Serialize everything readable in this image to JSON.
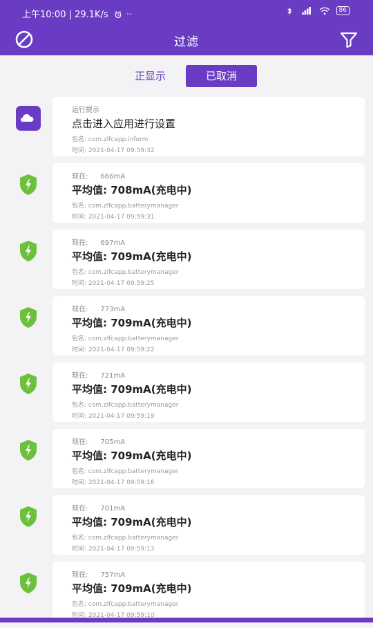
{
  "status_bar": {
    "left_text": "上午10:00 | 29.1K/s",
    "alarm_icon": "alarm-clock-icon",
    "more_dots": "··",
    "icons": [
      "bluetooth-icon",
      "signal-icon",
      "wifi-icon",
      "battery-icon"
    ],
    "battery_text": "86"
  },
  "app_bar": {
    "title": "过滤",
    "left_icon": "block-icon",
    "right_icon": "filter-icon"
  },
  "segmented": {
    "options": [
      "正显示",
      "已取消"
    ],
    "selected_index": 1
  },
  "colors": {
    "primary": "#6a3cc4",
    "green": "#6cc03c",
    "background": "#f3f3f5"
  },
  "notifications": [
    {
      "type": "app",
      "icon": "cloud-app-icon",
      "line1_label": "运行提示",
      "line1_value": "",
      "title": "点击进入应用进行设置",
      "package_label": "包名:",
      "package": "com.zlfcapp.inform",
      "time_label": "时间:",
      "time": "2021-04-17 09:59:32"
    },
    {
      "type": "battery",
      "icon": "shield-battery-icon",
      "line1_label": "现在:",
      "line1_value": "666mA",
      "title": "平均值:  708mA(充电中)",
      "package_label": "包名:",
      "package": "com.zlfcapp.batterymanager",
      "time_label": "时间:",
      "time": "2021-04-17 09:59:31"
    },
    {
      "type": "battery",
      "icon": "shield-battery-icon",
      "line1_label": "现在:",
      "line1_value": "697mA",
      "title": "平均值:  709mA(充电中)",
      "package_label": "包名:",
      "package": "com.zlfcapp.batterymanager",
      "time_label": "时间:",
      "time": "2021-04-17 09:59:25"
    },
    {
      "type": "battery",
      "icon": "shield-battery-icon",
      "line1_label": "现在:",
      "line1_value": "773mA",
      "title": "平均值:  709mA(充电中)",
      "package_label": "包名:",
      "package": "com.zlfcapp.batterymanager",
      "time_label": "时间:",
      "time": "2021-04-17 09:59:22"
    },
    {
      "type": "battery",
      "icon": "shield-battery-icon",
      "line1_label": "现在:",
      "line1_value": "721mA",
      "title": "平均值:  709mA(充电中)",
      "package_label": "包名:",
      "package": "com.zlfcapp.batterymanager",
      "time_label": "时间:",
      "time": "2021-04-17 09:59:19"
    },
    {
      "type": "battery",
      "icon": "shield-battery-icon",
      "line1_label": "现在:",
      "line1_value": "705mA",
      "title": "平均值:  709mA(充电中)",
      "package_label": "包名:",
      "package": "com.zlfcapp.batterymanager",
      "time_label": "时间:",
      "time": "2021-04-17 09:59:16"
    },
    {
      "type": "battery",
      "icon": "shield-battery-icon",
      "line1_label": "现在:",
      "line1_value": "701mA",
      "title": "平均值:  709mA(充电中)",
      "package_label": "包名:",
      "package": "com.zlfcapp.batterymanager",
      "time_label": "时间:",
      "time": "2021-04-17 09:59:13"
    },
    {
      "type": "battery",
      "icon": "shield-battery-icon",
      "line1_label": "现在:",
      "line1_value": "757mA",
      "title": "平均值:  709mA(充电中)",
      "package_label": "包名:",
      "package": "com.zlfcapp.batterymanager",
      "time_label": "时间:",
      "time": "2021-04-17 09:59:10"
    }
  ]
}
